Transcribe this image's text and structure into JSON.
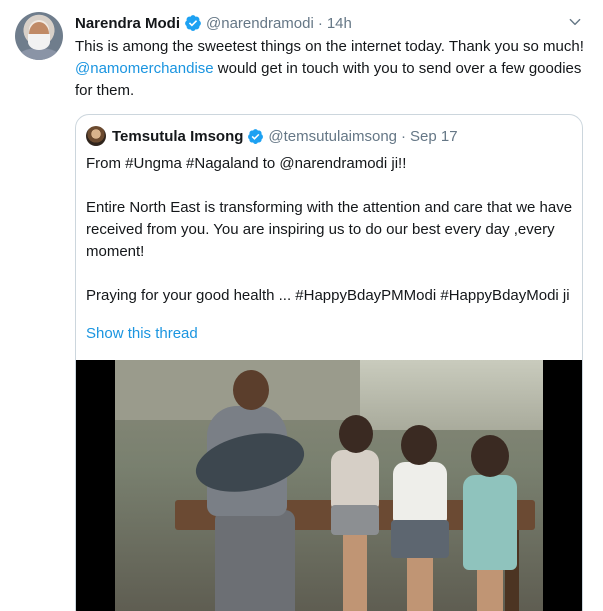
{
  "tweet": {
    "author_name": "Narendra Modi",
    "author_handle": "@narendramodi",
    "separator": "·",
    "time": "14h",
    "text_part1": "This is among the sweetest things on the internet today. Thank you so much! ",
    "mention": "@namomerchandise",
    "text_part2": " would get in touch with you to send over a few goodies for them."
  },
  "quoted": {
    "author_name": "Temsutula Imsong",
    "author_handle": "@temsutulaimsong",
    "separator": "·",
    "date": "Sep 17",
    "line1": "From #Ungma #Nagaland to @narendramodi ji!!",
    "line2": "Entire North East is transforming with the attention and care that we have received from you. You are inspiring us to do our best every day ,every moment!",
    "line3": "Praying for your good health ... #HappyBdayPMModi #HappyBdayModi ji",
    "show_thread": "Show this thread"
  },
  "colors": {
    "accent": "#1b95e0",
    "muted": "#657786",
    "border": "#ccd6dd",
    "verified": "#1da1f2"
  },
  "icons": {
    "verified": "verified-badge-icon",
    "caret": "chevron-down-icon"
  }
}
